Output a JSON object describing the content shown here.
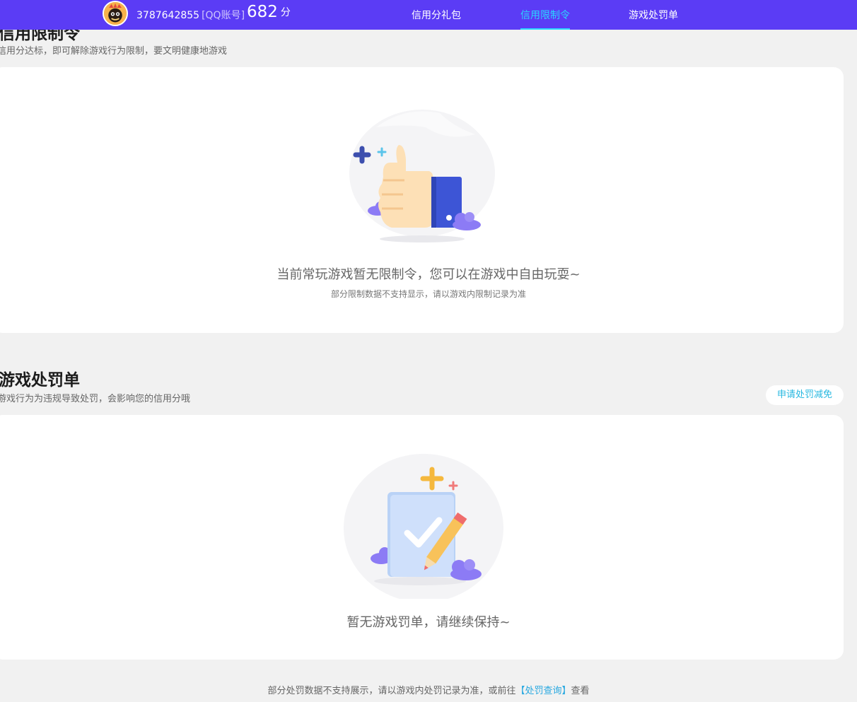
{
  "header": {
    "account_id": "3787642855",
    "account_type": "[QQ账号]",
    "score": "682",
    "score_unit": "分",
    "tabs": [
      {
        "label": "信用分礼包",
        "active": false
      },
      {
        "label": "信用限制令",
        "active": true
      },
      {
        "label": "游戏处罚单",
        "active": false
      }
    ],
    "bg_color": "#5b3cf5",
    "active_color": "#2ad6ff"
  },
  "restriction": {
    "title": "信用限制令",
    "subtitle": "信用分达标，即可解除游戏行为限制，要文明健康地游戏",
    "empty_main": "当前常玩游戏暂无限制令，您可以在游戏中自由玩耍~",
    "empty_sub": "部分限制数据不支持显示，请以游戏内限制记录为准",
    "icon": "thumbs-up-illustration"
  },
  "penalty": {
    "title": "游戏处罚单",
    "subtitle": "游戏行为为违规导致处罚，会影响您的信用分哦",
    "appeal_button": "申请处罚减免",
    "empty_main": "暂无游戏罚单，请继续保持~",
    "icon": "checklist-pencil-illustration"
  },
  "footer": {
    "prefix": "部分处罚数据不支持展示，请以游戏内处罚记录为准，或前往",
    "link": "【处罚查询】",
    "suffix": "查看"
  }
}
